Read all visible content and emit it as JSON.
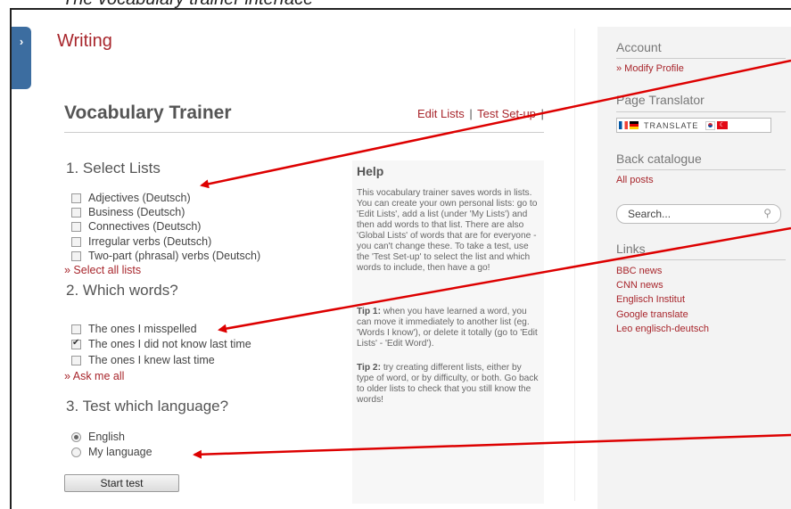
{
  "caption": "The vocabulary trainer interface",
  "side_tab": {
    "icon": "›"
  },
  "page": {
    "title": "Writing"
  },
  "trainer": {
    "title": "Vocabulary Trainer",
    "edit_lists": "Edit Lists",
    "separator": "|",
    "test_setup": "Test Set-up",
    "trailing_sep": "|"
  },
  "select_lists": {
    "heading": "1. Select Lists",
    "items": [
      {
        "label": "Adjectives (Deutsch)",
        "checked": false
      },
      {
        "label": "Business (Deutsch)",
        "checked": false
      },
      {
        "label": "Connectives (Deutsch)",
        "checked": false
      },
      {
        "label": "Irregular verbs (Deutsch)",
        "checked": false
      },
      {
        "label": "Two-part (phrasal) verbs (Deutsch)",
        "checked": false
      }
    ],
    "select_all": "» Select all lists"
  },
  "which_words": {
    "heading": "2. Which words?",
    "items": [
      {
        "label": "The ones I misspelled",
        "checked": false
      },
      {
        "label": "The ones I did not know last time",
        "checked": true
      },
      {
        "label": "The ones I knew last time",
        "checked": false
      }
    ],
    "ask_all": "» Ask me all"
  },
  "language": {
    "heading": "3. Test which language?",
    "items": [
      {
        "label": "English",
        "selected": true
      },
      {
        "label": "My language",
        "selected": false
      }
    ]
  },
  "start_button": "Start test",
  "help": {
    "title": "Help",
    "intro": "This vocabulary trainer saves words in lists. You can create your own personal lists: go to 'Edit Lists', add a list (under 'My Lists') and then add words to that list. There are also 'Global Lists' of words that are for everyone - you can't change these. To take a test, use the 'Test Set-up' to select the list and which words to include, then have a go!",
    "tip1_label": "Tip 1:",
    "tip1": " when you have learned a word, you can move it immediately to another list (eg. 'Words I know'), or delete it totally (go to 'Edit Lists' - 'Edit Word').",
    "tip2_label": "Tip 2:",
    "tip2": " try creating different lists, either by type of word, or by difficulty, or both. Go back to older lists to check that you still know the words!"
  },
  "sidebar": {
    "account_heading": "Account",
    "modify_profile": "» Modify Profile",
    "translator_heading": "Page Translator",
    "translate_label": "TRANSLATE",
    "catalogue_heading": "Back catalogue",
    "all_posts": "All posts",
    "search_placeholder": "Search...",
    "links_heading": "Links",
    "links": [
      "BBC news",
      "CNN news",
      "Englisch Institut",
      "Google translate",
      "Leo englisch-deutsch"
    ]
  },
  "colors": {
    "accent": "#a8262c",
    "arrow": "#dd0000",
    "tab": "#3c6da0"
  }
}
